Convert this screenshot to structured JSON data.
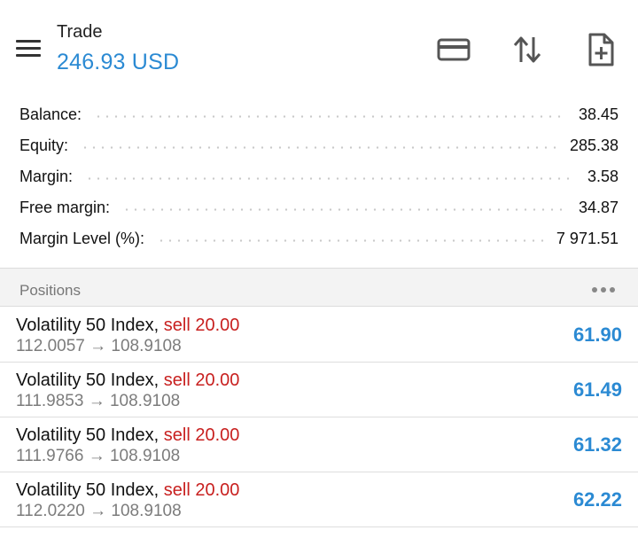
{
  "header": {
    "title": "Trade",
    "balance_display": "246.93 USD",
    "icons": [
      "menu-icon",
      "credit-card-icon",
      "sort-arrows-icon",
      "new-order-icon"
    ]
  },
  "summary": [
    {
      "label": "Balance:",
      "value": "38.45"
    },
    {
      "label": "Equity:",
      "value": "285.38"
    },
    {
      "label": "Margin:",
      "value": "3.58"
    },
    {
      "label": "Free margin:",
      "value": "34.87"
    },
    {
      "label": "Margin Level (%):",
      "value": "7 971.51"
    }
  ],
  "positions_section": {
    "label": "Positions",
    "more_icon": "more-dots-icon"
  },
  "positions": [
    {
      "symbol": "Volatility 50 Index,",
      "side": "sell 20.00",
      "prices": "112.0057 → 108.9108",
      "profit": "61.90"
    },
    {
      "symbol": "Volatility 50 Index,",
      "side": "sell 20.00",
      "prices": "111.9853 → 108.9108",
      "profit": "61.49"
    },
    {
      "symbol": "Volatility 50 Index,",
      "side": "sell 20.00",
      "prices": "111.9766 → 108.9108",
      "profit": "61.32"
    },
    {
      "symbol": "Volatility 50 Index,",
      "side": "sell 20.00",
      "prices": "112.0220 → 108.9108",
      "profit": "62.22"
    }
  ],
  "colors": {
    "accent": "#2b8ad3",
    "sell": "#c8201f",
    "muted": "#7c7c7c",
    "section_bg": "#f3f3f3"
  }
}
